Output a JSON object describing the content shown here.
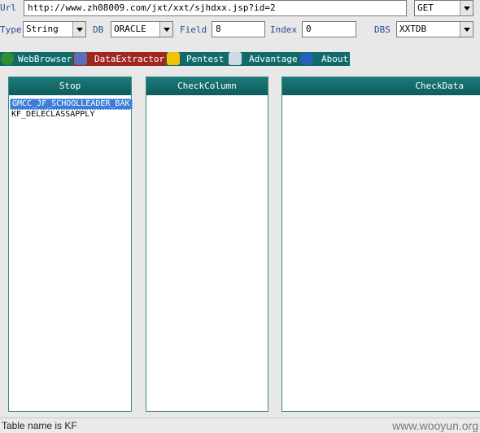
{
  "form": {
    "url_label": "Url",
    "url_value": "http://www.zh08009.com/jxt/xxt/sjhdxx.jsp?id=2",
    "method_value": "GET",
    "type_label": "Type",
    "type_value": "String",
    "db_label": "DB",
    "db_value": "ORACLE",
    "field_label": "Field",
    "field_value": "8",
    "index_label": "Index",
    "index_value": "0",
    "dbs_label": "DBS",
    "dbs_value": "XXTDB"
  },
  "tabs": [
    {
      "label": "WebBrowser",
      "icon": "globe-icon",
      "color": "#2f8f2f"
    },
    {
      "label": "DataExtractor",
      "icon": "database-icon",
      "color": "#5a6fb5",
      "active": true
    },
    {
      "label": "Pentest",
      "icon": "radiation-icon",
      "color": "#f2c200"
    },
    {
      "label": "Advantage",
      "icon": "tools-icon",
      "color": "#cfd8e6"
    },
    {
      "label": "About",
      "icon": "info-icon",
      "color": "#2b5fbf"
    }
  ],
  "panels": {
    "stop": {
      "header": "Stop",
      "items": [
        "GMCC_JF_SCHOOLLEADER_BAK",
        "KF_DELECLASSAPPLY"
      ]
    },
    "check_column": {
      "header": "CheckColumn"
    },
    "check_data": {
      "header": "CheckData"
    }
  },
  "status": {
    "text": "Table name is KF",
    "watermark": "www.wooyun.org"
  },
  "colors": {
    "teal": "#126b6b",
    "active_tab": "#a0261f",
    "selection": "#3b7dd8"
  }
}
